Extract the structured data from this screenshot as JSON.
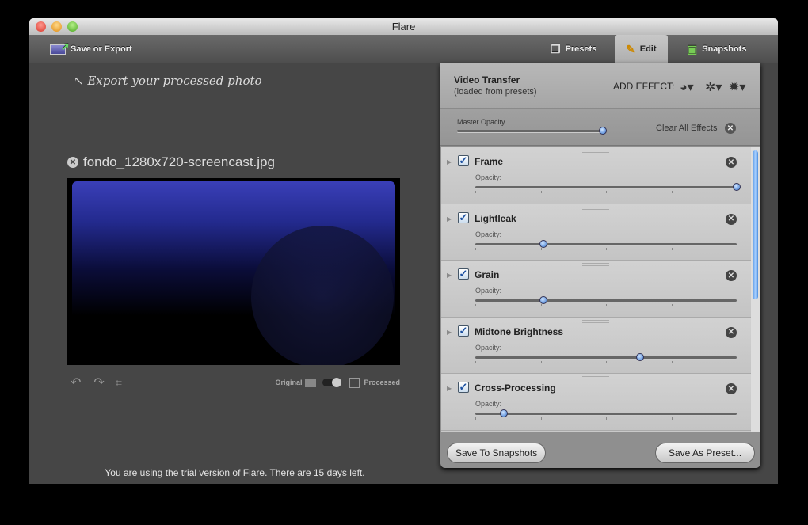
{
  "window": {
    "title": "Flare"
  },
  "toolbar": {
    "save_export": "Save or Export",
    "tabs": [
      {
        "label": "Presets"
      },
      {
        "label": "Edit",
        "active": true
      },
      {
        "label": "Snapshots"
      }
    ]
  },
  "hint": "Export your processed photo",
  "image": {
    "filename": "fondo_1280x720-screencast.jpg"
  },
  "photo_tools": {
    "original": "Original",
    "processed": "Processed"
  },
  "trial": "You are using the trial version of Flare. There are 15 days left.",
  "panel": {
    "title": "Video Transfer",
    "subtitle": "(loaded from presets)",
    "add_effect": "ADD EFFECT:",
    "master_opacity_label": "Master Opacity",
    "master_opacity": 1.0,
    "clear_all": "Clear All Effects",
    "opacity_label": "Opacity:",
    "effects": [
      {
        "name": "Frame",
        "enabled": true,
        "opacity": 1.0
      },
      {
        "name": "Lightleak",
        "enabled": true,
        "opacity": 0.26
      },
      {
        "name": "Grain",
        "enabled": true,
        "opacity": 0.26
      },
      {
        "name": "Midtone Brightness",
        "enabled": true,
        "opacity": 0.63
      },
      {
        "name": "Cross-Processing",
        "enabled": true,
        "opacity": 0.11
      }
    ],
    "save_snapshots": "Save To Snapshots",
    "save_preset": "Save As Preset..."
  },
  "colors": {
    "accent": "#3a78d0",
    "window_bg": "#464646"
  }
}
